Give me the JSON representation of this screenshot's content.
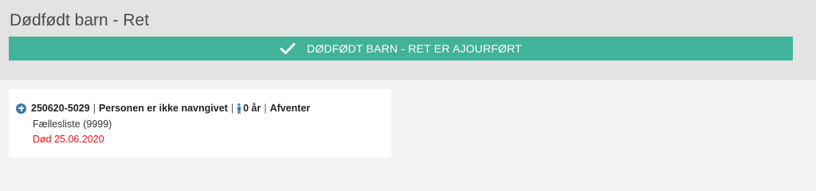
{
  "header": {
    "title": "Dødfødt barn - Ret"
  },
  "banner": {
    "message": "DØDFØDT BARN - RET ER AJOURFØRT",
    "color": "#42b29a"
  },
  "person": {
    "cpr": "250620-5029",
    "name_status": "Personen er ikke navngivet",
    "age": "0 år",
    "status": "Afventer",
    "list": "Fællesliste (9999)",
    "death": "Død 25.06.2020",
    "death_color": "#e0141e"
  }
}
